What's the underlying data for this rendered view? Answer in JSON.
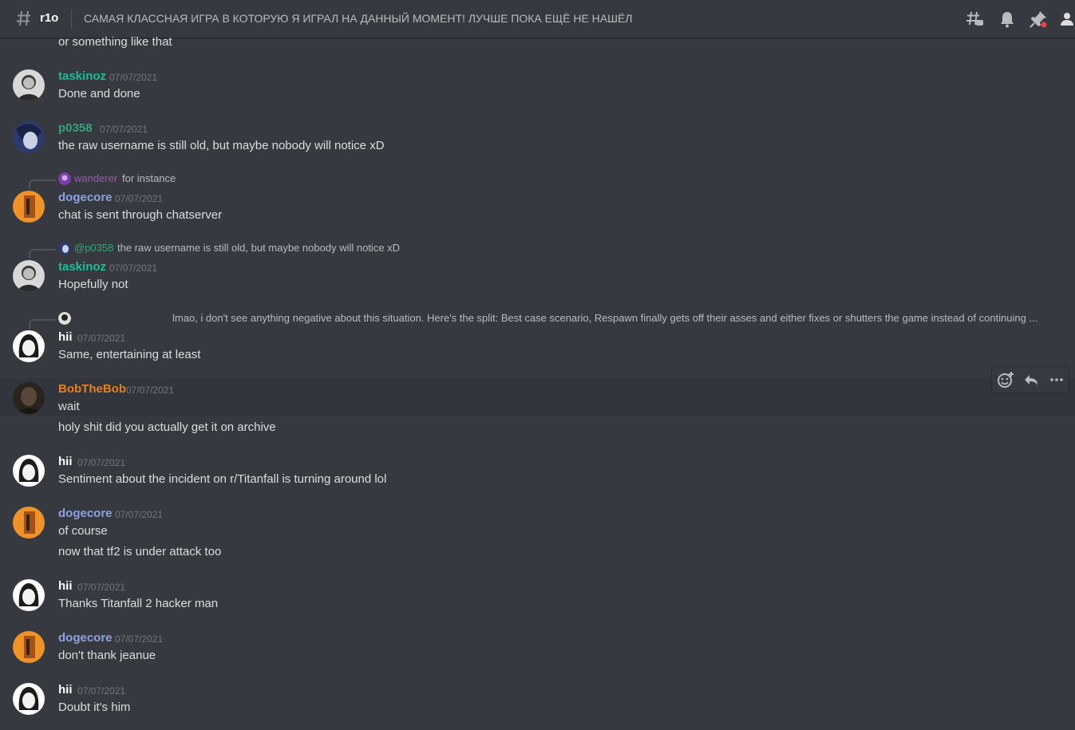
{
  "header": {
    "channel_name": "r1o",
    "topic": "САМАЯ КЛАССНАЯ ИГРА В КОТОРУЮ Я ИГРАЛ НА ДАННЫЙ МОМЕНТ! ЛУЧШЕ ПОКА ЕЩЁ НЕ НАШЁЛ",
    "icons": [
      "threads-icon",
      "bell-icon",
      "pin-icon",
      "members-icon"
    ]
  },
  "colors": {
    "background": "#36393f",
    "taskinoz": "#1abc9c",
    "p0358": "#3aa37a",
    "dogecore": "#8ea1e1",
    "hii": "#ffffff",
    "bobthebob": "#e67e22",
    "wanderer": "#9b59b6"
  },
  "messages": {
    "m0": {
      "text": "or something like that"
    },
    "m1": {
      "username": "taskinoz",
      "timestamp": "07/07/2021",
      "text": "Done and done"
    },
    "m2": {
      "username": "p0358",
      "timestamp": "07/07/2021",
      "text": "the raw username is still old, but maybe nobody will notice xD"
    },
    "m3": {
      "reply": {
        "username": "wanderer",
        "text": "for instance"
      },
      "username": "dogecore",
      "timestamp": "07/07/2021",
      "text": "chat is sent through chatserver"
    },
    "m4": {
      "reply": {
        "username": "@p0358",
        "text": "the raw username is still old, but maybe nobody will notice xD"
      },
      "username": "taskinoz",
      "timestamp": "07/07/2021",
      "text": "Hopefully not"
    },
    "m5": {
      "reply": {
        "text": "lmao, i don't see anything negative about this situation. Here's the split: Best case scenario, Respawn finally gets off their asses and either fixes or shutters the game instead of continuing ..."
      },
      "username": "hii",
      "timestamp": "07/07/2021",
      "text": "Same, entertaining at least"
    },
    "m6": {
      "username": "BobTheBob",
      "timestamp": "07/07/2021",
      "text": "wait",
      "text2": "holy shit did you actually get it on archive"
    },
    "m7": {
      "username": "hii",
      "timestamp": "07/07/2021",
      "text": "Sentiment about the incident on r/Titanfall is turning around lol"
    },
    "m8": {
      "username": "dogecore",
      "timestamp": "07/07/2021",
      "text": "of course",
      "text2": "now that tf2 is under attack too"
    },
    "m9": {
      "username": "hii",
      "timestamp": "07/07/2021",
      "text": "Thanks Titanfall 2 hacker man"
    },
    "m10": {
      "username": "dogecore",
      "timestamp": "07/07/2021",
      "text": "don't thank jeanue"
    },
    "m11": {
      "username": "hii",
      "timestamp": "07/07/2021",
      "text": "Doubt it's him"
    }
  },
  "hover_toolbar": {
    "icons": [
      "add-reaction-icon",
      "reply-icon",
      "more-icon"
    ]
  }
}
